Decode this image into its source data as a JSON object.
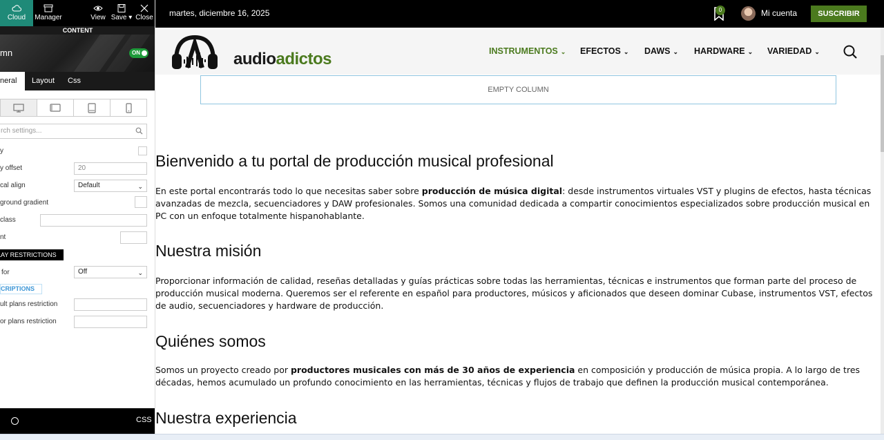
{
  "editor": {
    "toolbar": {
      "cloud": "Cloud",
      "manager": "Manager",
      "view": "View",
      "save": "Save",
      "close": "Close"
    },
    "content_label": "CONTENT",
    "element_title": "mn",
    "toggle_label": "ON",
    "tabs": {
      "general": "neral",
      "layout": "Layout",
      "css": "Css"
    },
    "search_placeholder": "rch settings...",
    "fields": {
      "f1_label": "y",
      "f2_label": "y offset",
      "f2_value": "20",
      "f3_label": "cal align",
      "f3_value": "Default",
      "f4_label": "ground gradient",
      "f5_label": "class",
      "f6_label": "nt",
      "f7_label": "for",
      "f7_value": "Off",
      "f8_label": "ult plans restriction",
      "f9_label": "or plans restriction"
    },
    "display_restrictions": "LAY RESTRICTIONS",
    "subscriptions_tab": "CRIPTIONS",
    "footer_css": "CSS",
    "accent_color": "#1f8a78"
  },
  "topbar": {
    "date": "martes, diciembre 16, 2025",
    "bookmark_count": "0",
    "account": "Mi cuenta",
    "subscribe": "SUSCRIBIR"
  },
  "nav": {
    "logo_part1": "audio",
    "logo_part2": "adictos",
    "items": [
      "INSTRUMENTOS",
      "EFECTOS",
      "DAWS",
      "HARDWARE",
      "VARIEDAD"
    ],
    "brand_color": "#4b7a1e"
  },
  "empty_column": "EMPTY COLUMN",
  "article": {
    "h1": "Bienvenido a tu portal de producción musical profesional",
    "p1_a": "En este portal encontrarás todo lo que necesitas saber sobre ",
    "p1_b": "producción de música digital",
    "p1_c": ": desde instrumentos virtuales VST y plugins de efectos, hasta técnicas avanzadas de mezcla, secuenciadores y DAW profesionales. Somos una comunidad dedicada a compartir conocimientos especializados sobre producción musical en PC con un enfoque totalmente hispanohablante.",
    "h2": "Nuestra misión",
    "p2": "Proporcionar información de calidad, reseñas detalladas y guías prácticas sobre todas las herramientas, técnicas e instrumentos que forman parte del proceso de producción musical moderna. Queremos ser el referente en español para productores, músicos y aficionados que deseen dominar Cubase, instrumentos VST, efectos de audio, secuenciadores y hardware de producción.",
    "h3": "Quiénes somos",
    "p3_a": "Somos un proyecto creado por ",
    "p3_b": "productores musicales con más de 30 años de experiencia",
    "p3_c": " en composición y producción de música propia. A lo largo de tres décadas, hemos acumulado un profundo conocimiento en las herramientas, técnicas y flujos de trabajo que definen la producción musical contemporánea.",
    "h4": "Nuestra experiencia"
  }
}
